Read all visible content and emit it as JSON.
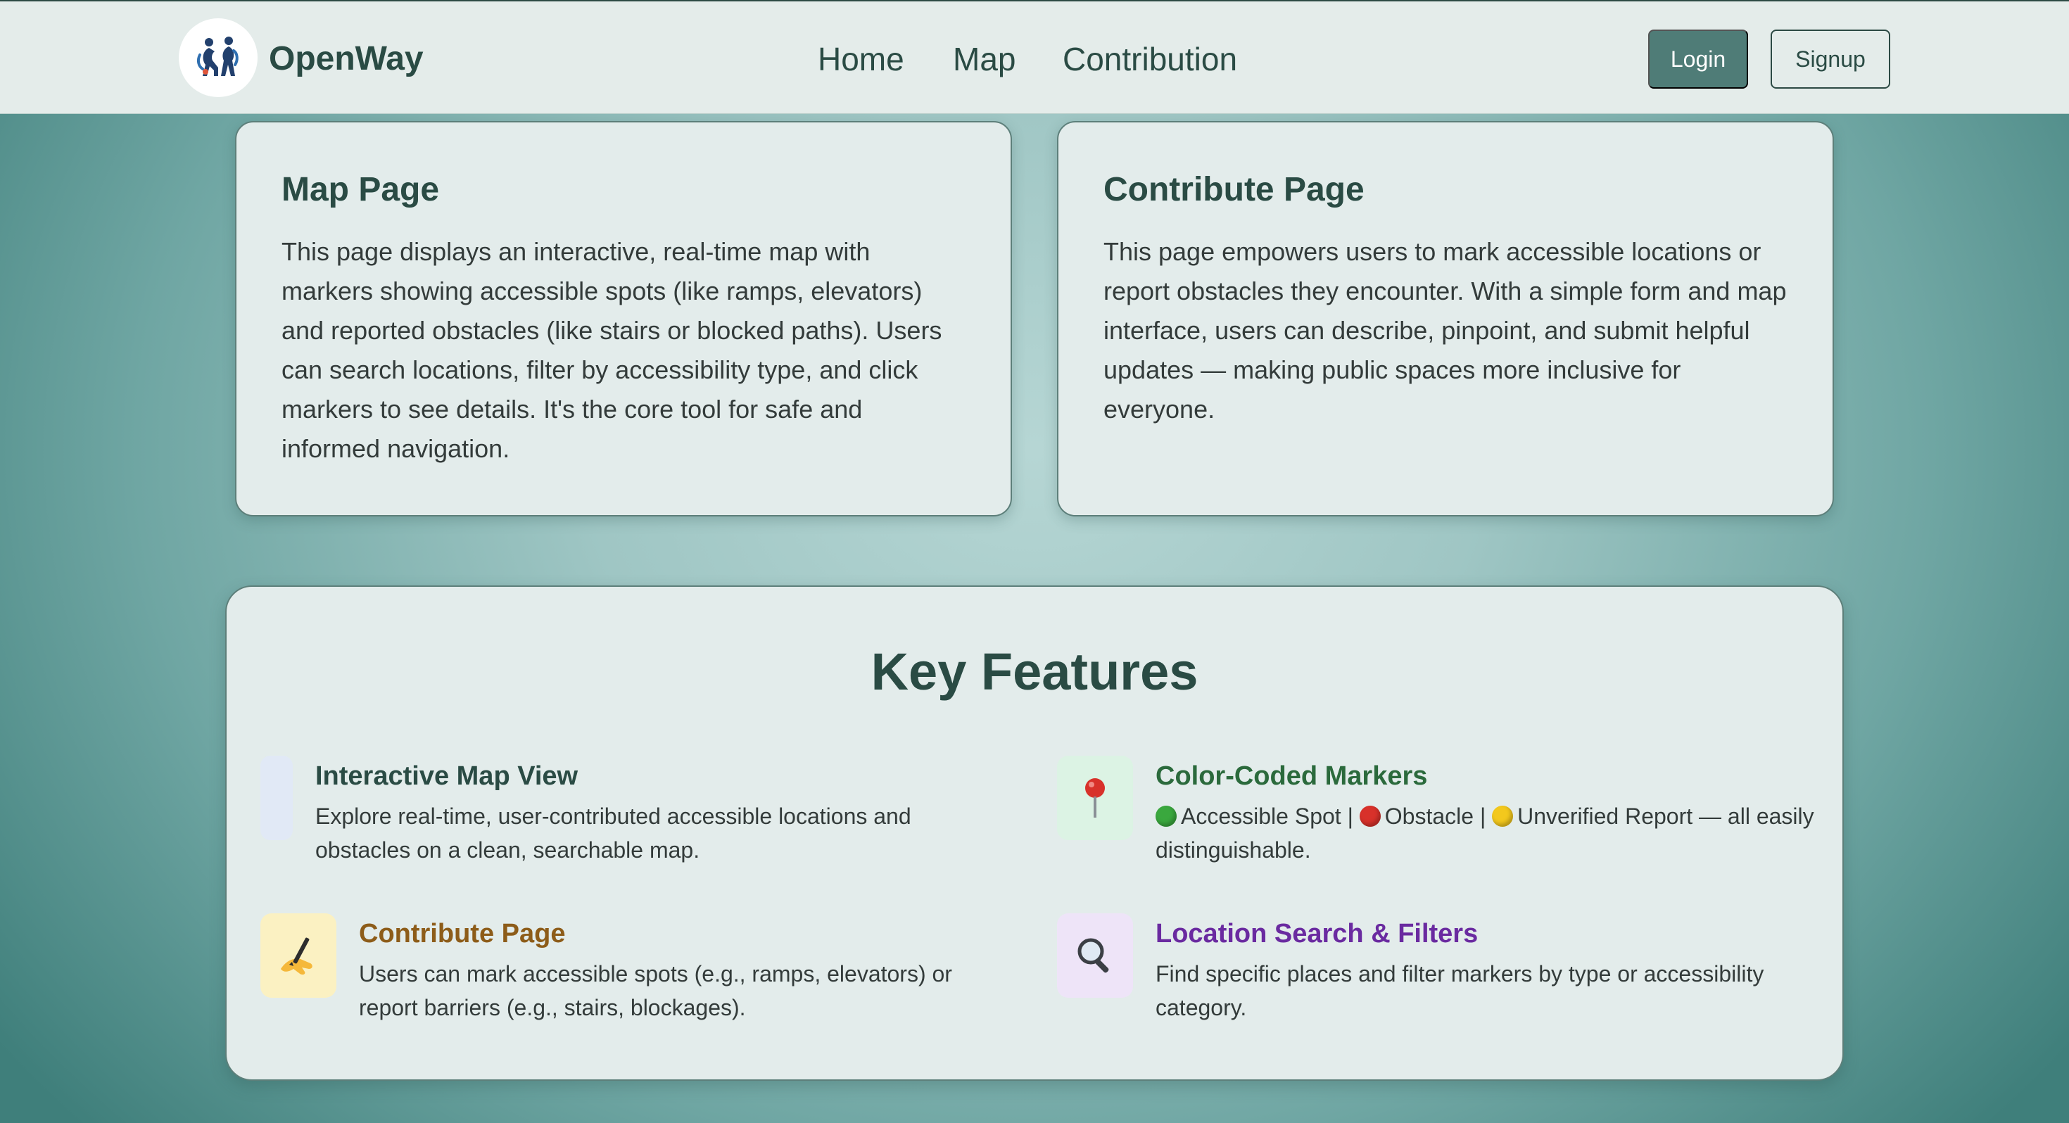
{
  "header": {
    "brand": "OpenWay",
    "nav": [
      "Home",
      "Map",
      "Contribution"
    ],
    "login_label": "Login",
    "signup_label": "Signup"
  },
  "cards": [
    {
      "title": "Map Page",
      "text": "This page displays an interactive, real-time map with markers showing accessible spots (like ramps, elevators) and reported obstacles (like stairs or blocked paths). Users can search locations, filter by accessibility type, and click markers to see details. It's the core tool for safe and informed navigation."
    },
    {
      "title": "Contribute Page",
      "text": "This page empowers users to mark accessible locations or report obstacles they encounter. With a simple form and map interface, users can describe, pinpoint, and submit helpful updates — making public spaces more inclusive for everyone."
    }
  ],
  "features": {
    "title": "Key Features",
    "items": [
      {
        "icon": "map-icon",
        "title": "Interactive Map View",
        "desc": "Explore real-time, user-contributed accessible locations and obstacles on a clean, searchable map."
      },
      {
        "icon": "pushpin-icon",
        "title": "Color-Coded Markers",
        "legend": [
          "Accessible Spot",
          "Obstacle",
          "Unverified Report"
        ],
        "separator": " | ",
        "desc_tail": " — all easily distinguishable."
      },
      {
        "icon": "writing-hand-icon",
        "title": "Contribute Page",
        "desc": "Users can mark accessible spots (e.g., ramps, elevators) or report barriers (e.g., stairs, blockages)."
      },
      {
        "icon": "magnifier-icon",
        "title": "Location Search & Filters",
        "desc": "Find specific places and filter markers by type or accessibility category."
      }
    ]
  },
  "colors": {
    "accent": "#2a4b44",
    "login_bg": "#4f7c77",
    "feature_green": "#2b6a3c",
    "feature_orange": "#8d5c19",
    "feature_purple": "#6a2aa0"
  }
}
